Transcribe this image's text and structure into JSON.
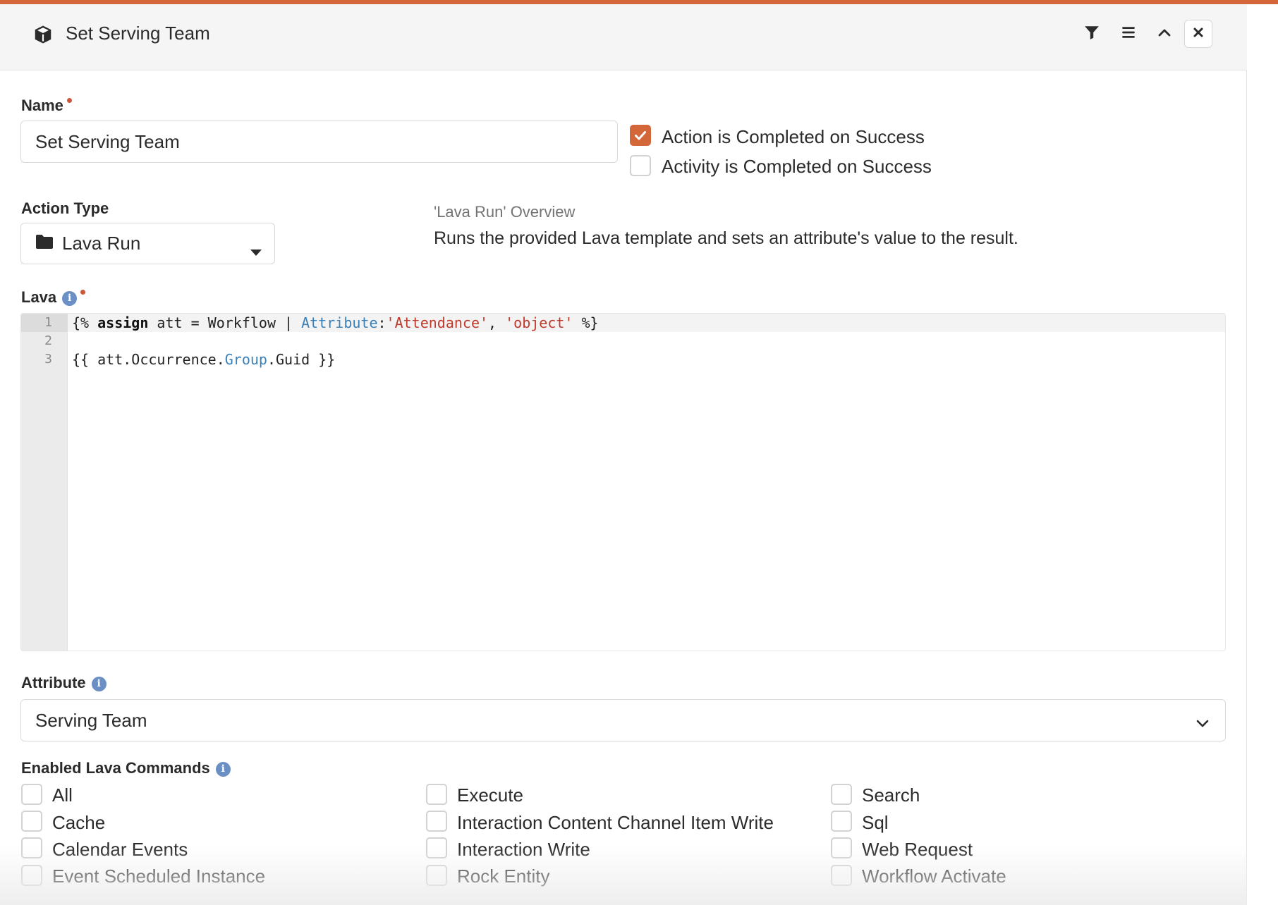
{
  "header": {
    "title": "Set Serving Team"
  },
  "name_field": {
    "label": "Name",
    "value": "Set Serving Team"
  },
  "options": {
    "action_completed": {
      "label": "Action is Completed on Success",
      "checked": true
    },
    "activity_completed": {
      "label": "Activity is Completed on Success",
      "checked": false
    }
  },
  "action_type": {
    "label": "Action Type",
    "value": "Lava Run"
  },
  "overview": {
    "title": "'Lava Run' Overview",
    "text": "Runs the provided Lava template and sets an attribute's value to the result."
  },
  "lava": {
    "label": "Lava",
    "line_numbers": [
      "1",
      "2",
      "3"
    ],
    "line1": {
      "open": "{% ",
      "assign": "assign",
      "middle": " att = Workflow | ",
      "attribute": "Attribute",
      "colon": ":",
      "arg1": "'Attendance'",
      "comma": ", ",
      "arg2": "'object'",
      "close": " %}"
    },
    "line3": {
      "start": "{{ att.Occurrence.",
      "group": "Group",
      "end": ".Guid }}"
    }
  },
  "attribute": {
    "label": "Attribute",
    "value": "Serving Team"
  },
  "lava_commands": {
    "label": "Enabled Lava Commands",
    "col1": [
      "All",
      "Cache",
      "Calendar Events",
      "Event Scheduled Instance"
    ],
    "col2": [
      "Execute",
      "Interaction Content Channel Item Write",
      "Interaction Write",
      "Rock Entity"
    ],
    "col3": [
      "Search",
      "Sql",
      "Web Request",
      "Workflow Activate"
    ]
  },
  "colors": {
    "accent": "#d4673a",
    "info": "#6a8fc4",
    "code_blue": "#3a80b8",
    "code_string": "#c0392b"
  },
  "icons": [
    "cube-icon",
    "filter-icon",
    "menu-icon",
    "chevron-up-icon",
    "close-icon",
    "folder-icon",
    "caret-down-icon",
    "chevron-down-icon",
    "info-icon",
    "check-icon"
  ]
}
